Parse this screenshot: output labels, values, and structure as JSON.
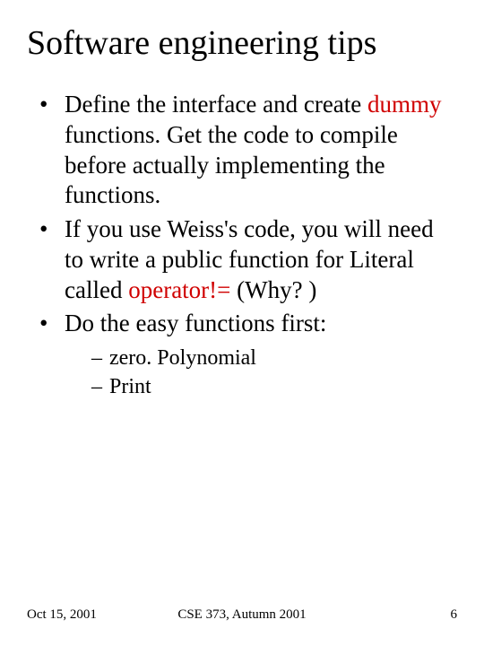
{
  "title": "Software engineering tips",
  "bullets": [
    {
      "pre": "Define the interface and create ",
      "red": "dummy",
      "post": " functions.  Get the code to compile before actually implementing the functions."
    },
    {
      "pre": "If you use Weiss's code, you will need to write a public function for Literal called ",
      "red": "operator!=",
      "post": "   (Why? )"
    },
    {
      "pre": "Do the easy functions first:",
      "red": "",
      "post": ""
    }
  ],
  "subbullets": [
    "zero. Polynomial",
    "Print"
  ],
  "footer": {
    "date": "Oct 15, 2001",
    "course": "CSE 373, Autumn 2001",
    "page": "6"
  }
}
